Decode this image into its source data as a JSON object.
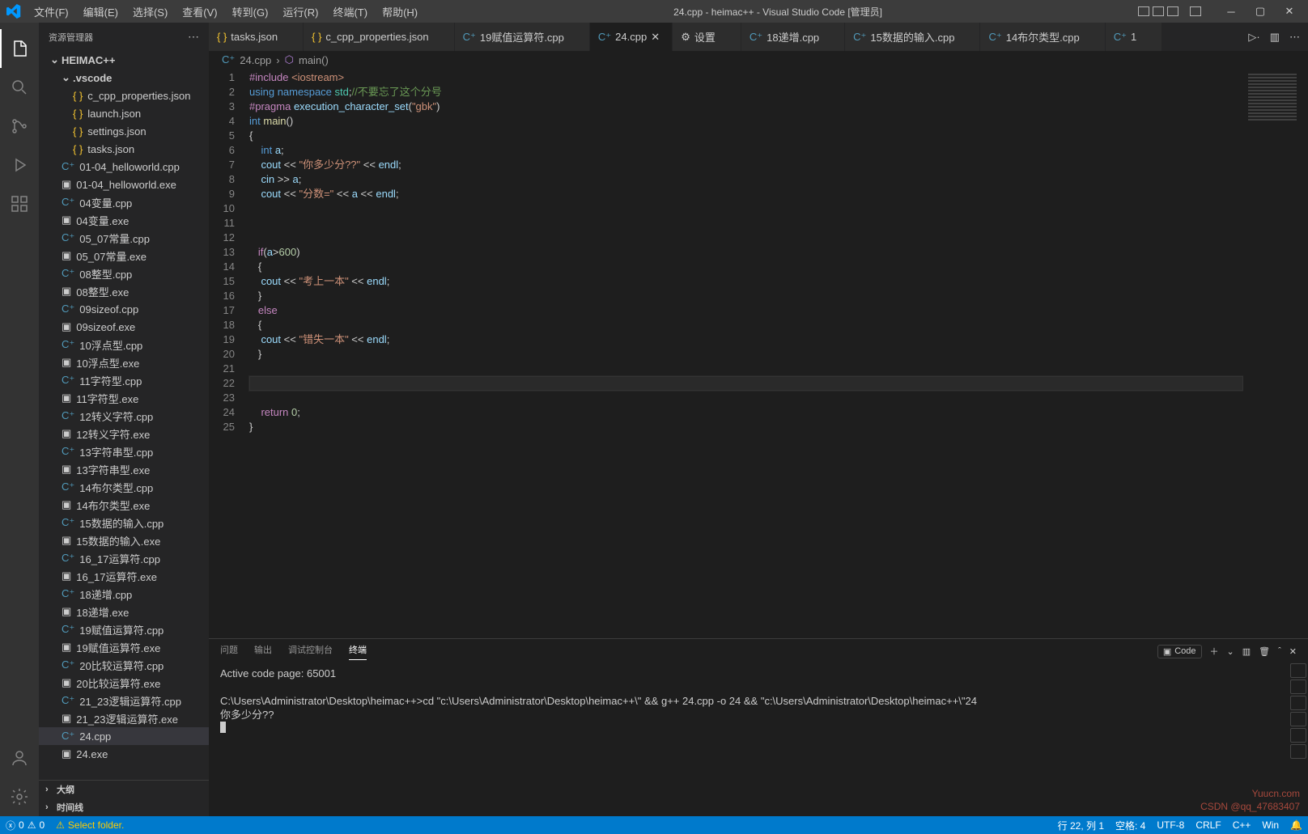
{
  "title": "24.cpp - heimac++ - Visual Studio Code [管理员]",
  "menu": [
    "文件(F)",
    "编辑(E)",
    "选择(S)",
    "查看(V)",
    "转到(G)",
    "运行(R)",
    "终端(T)",
    "帮助(H)"
  ],
  "sidebar": {
    "title": "资源管理器",
    "root": "HEIMAC++",
    "vscode_folder": ".vscode",
    "vscode_files": [
      "c_cpp_properties.json",
      "launch.json",
      "settings.json",
      "tasks.json"
    ],
    "files": [
      {
        "n": "01-04_helloworld.cpp",
        "t": "cpp"
      },
      {
        "n": "01-04_helloworld.exe",
        "t": "exe"
      },
      {
        "n": "04变量.cpp",
        "t": "cpp"
      },
      {
        "n": "04变量.exe",
        "t": "exe"
      },
      {
        "n": "05_07常量.cpp",
        "t": "cpp"
      },
      {
        "n": "05_07常量.exe",
        "t": "exe"
      },
      {
        "n": "08整型.cpp",
        "t": "cpp"
      },
      {
        "n": "08整型.exe",
        "t": "exe"
      },
      {
        "n": "09sizeof.cpp",
        "t": "cpp"
      },
      {
        "n": "09sizeof.exe",
        "t": "exe"
      },
      {
        "n": "10浮点型.cpp",
        "t": "cpp"
      },
      {
        "n": "10浮点型.exe",
        "t": "exe"
      },
      {
        "n": "11字符型.cpp",
        "t": "cpp"
      },
      {
        "n": "11字符型.exe",
        "t": "exe"
      },
      {
        "n": "12转义字符.cpp",
        "t": "cpp"
      },
      {
        "n": "12转义字符.exe",
        "t": "exe"
      },
      {
        "n": "13字符串型.cpp",
        "t": "cpp"
      },
      {
        "n": "13字符串型.exe",
        "t": "exe"
      },
      {
        "n": "14布尔类型.cpp",
        "t": "cpp"
      },
      {
        "n": "14布尔类型.exe",
        "t": "exe"
      },
      {
        "n": "15数据的输入.cpp",
        "t": "cpp"
      },
      {
        "n": "15数据的输入.exe",
        "t": "exe"
      },
      {
        "n": "16_17运算符.cpp",
        "t": "cpp"
      },
      {
        "n": "16_17运算符.exe",
        "t": "exe"
      },
      {
        "n": "18递增.cpp",
        "t": "cpp"
      },
      {
        "n": "18递增.exe",
        "t": "exe"
      },
      {
        "n": "19赋值运算符.cpp",
        "t": "cpp"
      },
      {
        "n": "19赋值运算符.exe",
        "t": "exe"
      },
      {
        "n": "20比较运算符.cpp",
        "t": "cpp"
      },
      {
        "n": "20比较运算符.exe",
        "t": "exe"
      },
      {
        "n": "21_23逻辑运算符.cpp",
        "t": "cpp"
      },
      {
        "n": "21_23逻辑运算符.exe",
        "t": "exe"
      },
      {
        "n": "24.cpp",
        "t": "cpp",
        "active": true
      },
      {
        "n": "24.exe",
        "t": "exe"
      }
    ],
    "outline": "大纲",
    "timeline": "时间线"
  },
  "tabs": [
    {
      "label": "tasks.json",
      "icon": "json"
    },
    {
      "label": "c_cpp_properties.json",
      "icon": "json"
    },
    {
      "label": "19赋值运算符.cpp",
      "icon": "cpp"
    },
    {
      "label": "24.cpp",
      "icon": "cpp",
      "active": true
    },
    {
      "label": "设置",
      "icon": "gear"
    },
    {
      "label": "18递增.cpp",
      "icon": "cpp"
    },
    {
      "label": "15数据的输入.cpp",
      "icon": "cpp"
    },
    {
      "label": "14布尔类型.cpp",
      "icon": "cpp"
    },
    {
      "label": "1",
      "icon": "cpp",
      "cut": true
    }
  ],
  "breadcrumbs": {
    "file": "24.cpp",
    "symbol": "main()"
  },
  "code_lines": 25,
  "panel": {
    "tabs": [
      "问题",
      "输出",
      "调试控制台",
      "终端"
    ],
    "active_tab": "终端",
    "code_label": "Code",
    "terminal_lines": [
      "Active code page: 65001",
      "",
      "C:\\Users\\Administrator\\Desktop\\heimac++>cd \"c:\\Users\\Administrator\\Desktop\\heimac++\\\" && g++ 24.cpp -o 24 && \"c:\\Users\\Administrator\\Desktop\\heimac++\\\"24",
      "你多少分??"
    ]
  },
  "status": {
    "errors": "0",
    "warnings": "0",
    "folder": "Select folder.",
    "pos": "行 22, 列 1",
    "spaces": "空格: 4",
    "encoding": "UTF-8",
    "eol": "CRLF",
    "lang": "C++",
    "win": "Win",
    "bell": "🔔"
  },
  "watermark1": "Yuucn.com",
  "watermark2": "CSDN @qq_47683407"
}
